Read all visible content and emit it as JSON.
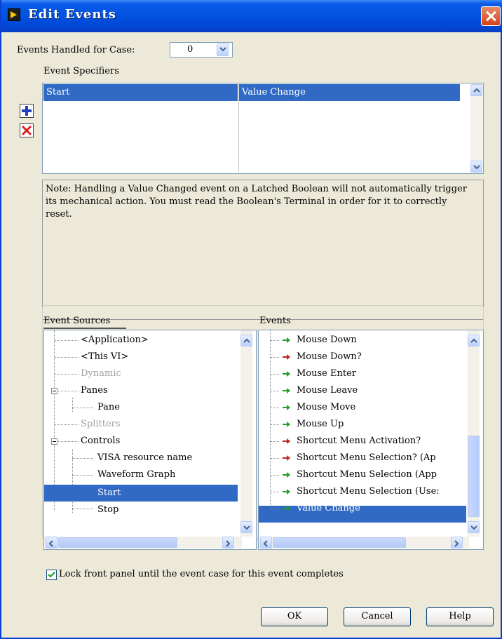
{
  "window": {
    "title": "Edit Events"
  },
  "events_handled": {
    "label": "Events Handled for Case:",
    "value": "0"
  },
  "specifiers": {
    "heading": "Event Specifiers",
    "columns": [
      "Start",
      "Value Change"
    ],
    "add_icon": "plus-icon",
    "remove_icon": "x-icon"
  },
  "note": "Note:  Handling a Value Changed event on a Latched Boolean will not automatically trigger its mechanical action. You must read the Boolean's Terminal in order for it to correctly reset.",
  "sources": {
    "heading": "Event Sources",
    "items": [
      {
        "label": "<Application>",
        "disabled": false
      },
      {
        "label": "<This VI>",
        "disabled": false
      },
      {
        "label": "Dynamic",
        "disabled": true
      },
      {
        "label": "Panes",
        "disabled": false
      },
      {
        "label": "Pane",
        "disabled": false
      },
      {
        "label": "Splitters",
        "disabled": true
      },
      {
        "label": "Controls",
        "disabled": false
      },
      {
        "label": "VISA resource name",
        "disabled": false
      },
      {
        "label": "Waveform Graph",
        "disabled": false
      },
      {
        "label": "Start",
        "disabled": false,
        "selected": true
      },
      {
        "label": "Stop",
        "disabled": false
      }
    ]
  },
  "events": {
    "heading": "Events",
    "items": [
      {
        "label": "Mouse Down",
        "filter": false
      },
      {
        "label": "Mouse Down?",
        "filter": true
      },
      {
        "label": "Mouse Enter",
        "filter": false
      },
      {
        "label": "Mouse Leave",
        "filter": false
      },
      {
        "label": "Mouse Move",
        "filter": false
      },
      {
        "label": "Mouse Up",
        "filter": false
      },
      {
        "label": "Shortcut Menu Activation?",
        "filter": true
      },
      {
        "label": "Shortcut Menu Selection? (Ap",
        "filter": true
      },
      {
        "label": "Shortcut Menu Selection (App",
        "filter": false
      },
      {
        "label": "Shortcut Menu Selection (Use:",
        "filter": false
      },
      {
        "label": "Value Change",
        "filter": false,
        "selected": true
      }
    ]
  },
  "lock": {
    "label": "Lock front panel until the event case for this event completes",
    "checked": true
  },
  "buttons": {
    "ok": "OK",
    "cancel": "Cancel",
    "help": "Help"
  },
  "colors": {
    "selection": "#316ac5",
    "notify_arrow": "#1fa01f",
    "filter_arrow": "#c02020",
    "titlebar": "#0352e0"
  }
}
